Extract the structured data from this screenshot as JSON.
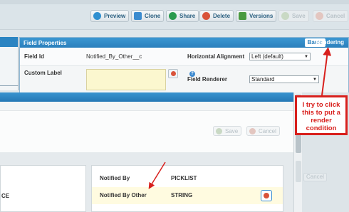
{
  "toolbar": {
    "preview": "Preview",
    "clone": "Clone",
    "share": "Share",
    "delete": "Delete",
    "versions": "Versions",
    "save": "Save",
    "cancel": "Cancel"
  },
  "field_properties": {
    "title": "Field Properties",
    "tabs": [
      "Basic",
      "Rendering"
    ],
    "field_id_label": "Field Id",
    "field_id_value": "Notified_By_Other__c",
    "custom_label_label": "Custom Label",
    "horizontal_alignment_label": "Horizontal Alignment",
    "horizontal_alignment_value": "Left (default)",
    "field_renderer_label": "Field Renderer",
    "field_renderer_value": "Standard"
  },
  "dialog": {
    "save": "Save",
    "cancel": "Cancel",
    "left_fragment": "CE",
    "rows": [
      {
        "name": "Notified By",
        "type": "PICKLIST"
      },
      {
        "name": "Notified By Other",
        "type": "STRING"
      }
    ]
  },
  "background": {
    "cancel": "Cancel"
  },
  "callout": {
    "text": "I try to click this to put a render condition"
  },
  "colors": {
    "header_blue": "#2a7fbc",
    "callout_red": "#d8201d",
    "highlight_yellow": "#fbf7cf"
  }
}
